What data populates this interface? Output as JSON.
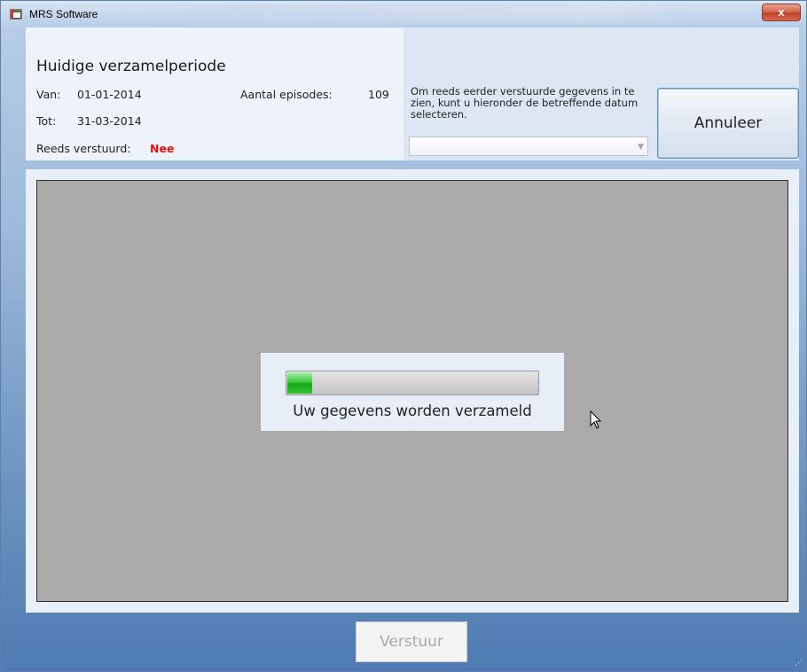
{
  "window": {
    "title": "MRS Software",
    "close_symbol": "x"
  },
  "header": {
    "title": "Huidige verzamelperiode",
    "van_label": "Van:",
    "van_value": "01-01-2014",
    "tot_label": "Tot:",
    "tot_value": "31-03-2014",
    "episodes_label": "Aantal episodes:",
    "episodes_value": "109",
    "sent_label": "Reeds verstuurd:",
    "sent_value": "Nee"
  },
  "history": {
    "info_text": "Om reeds eerder verstuurde gegevens in te zien, kunt u hieronder de betreffende datum selecteren.",
    "date_select_value": ""
  },
  "buttons": {
    "annuleer": "Annuleer",
    "verstuur": "Verstuur"
  },
  "progress": {
    "message": "Uw gegevens worden verzameld",
    "fraction": 0.1
  },
  "colors": {
    "accent_red": "#e01010",
    "progress_green": "#17a817"
  }
}
